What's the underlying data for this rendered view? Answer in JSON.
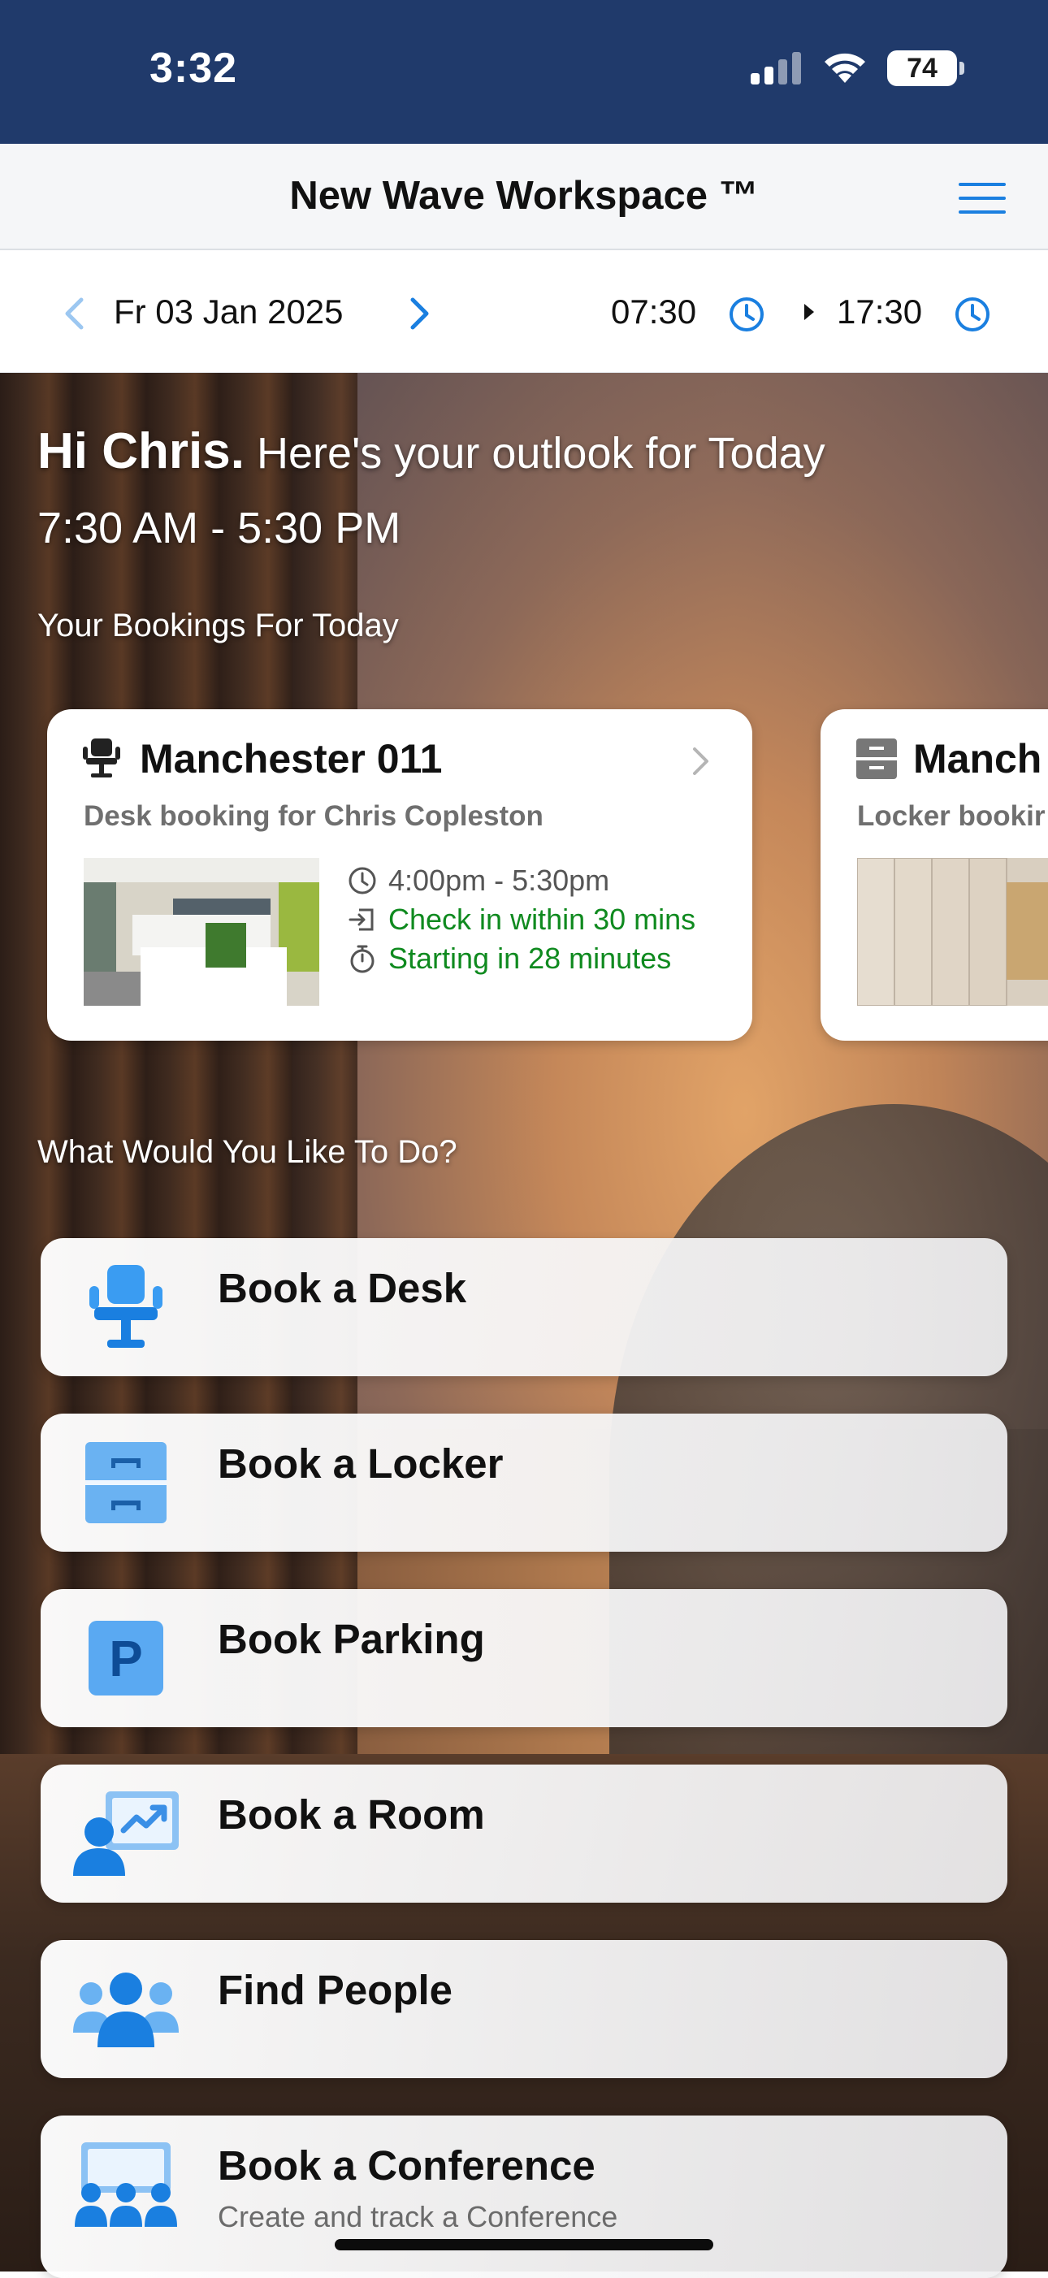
{
  "status_bar": {
    "time": "3:32",
    "battery": "74"
  },
  "header": {
    "title": "New Wave Workspace ™"
  },
  "date_bar": {
    "date": "Fr 03 Jan 2025",
    "start_time": "07:30",
    "end_time": "17:30"
  },
  "greeting": {
    "name": "Hi Chris.",
    "message": "Here's your outlook for Today",
    "time_range": "7:30 AM - 5:30 PM"
  },
  "bookings_label": "Your Bookings For Today",
  "bookings": [
    {
      "title": "Manchester 011",
      "subtitle": "Desk booking for Chris Copleston",
      "time": "4:00pm - 5:30pm",
      "checkin": "Check in within 30 mins",
      "starting": "Starting in 28 minutes"
    },
    {
      "title": "Manch",
      "subtitle": "Locker bookir"
    }
  ],
  "actions_label": "What Would You Like To Do?",
  "actions": [
    {
      "label": "Book a Desk",
      "icon": "desk-chair-icon"
    },
    {
      "label": "Book a Locker",
      "icon": "locker-icon"
    },
    {
      "label": "Book Parking",
      "icon": "parking-icon"
    },
    {
      "label": "Book a Room",
      "icon": "presentation-room-icon"
    },
    {
      "label": "Find People",
      "icon": "people-group-icon"
    },
    {
      "label": "Book a Conference",
      "sublabel": "Create and track a Conference",
      "icon": "conference-icon"
    }
  ],
  "colors": {
    "accent": "#1a7fe0",
    "status_bar": "#203a6b",
    "green": "#0f8a1f"
  }
}
